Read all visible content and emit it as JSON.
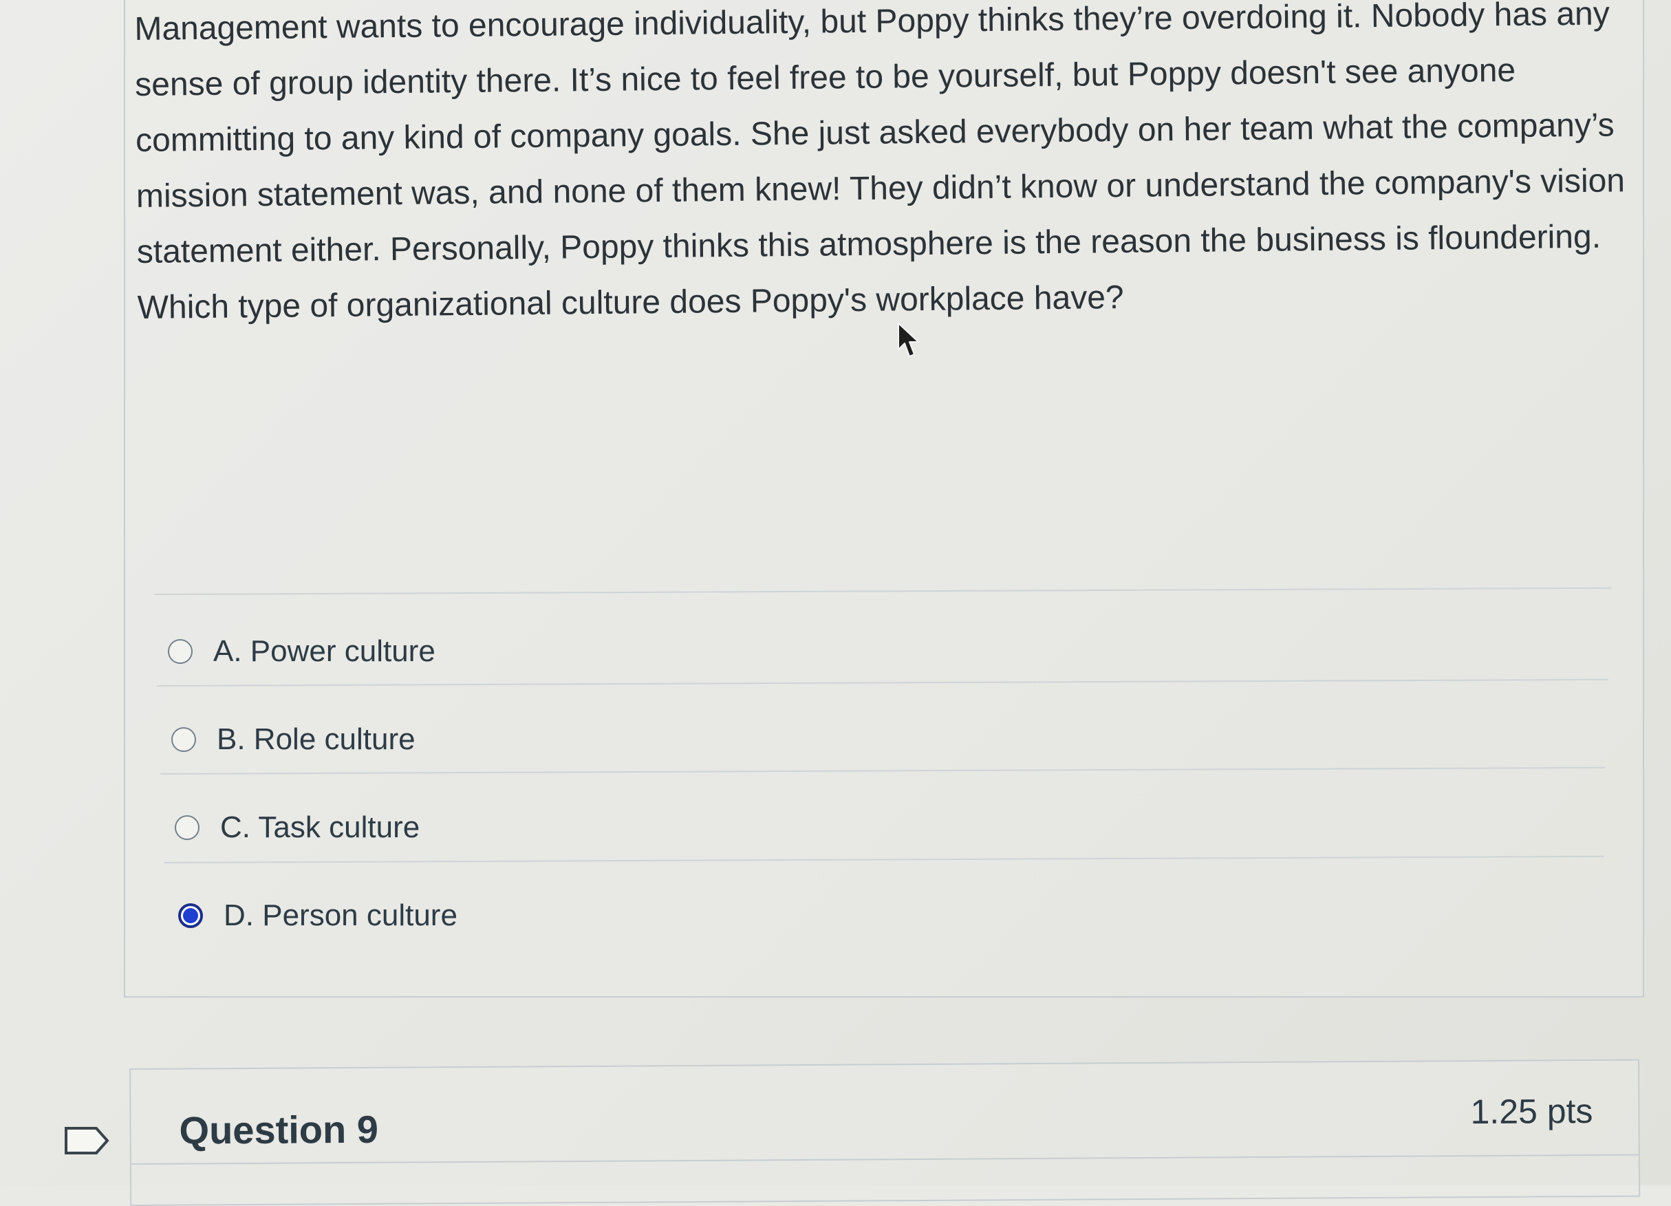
{
  "question": {
    "text": "Management wants to encourage individuality, but Poppy thinks they’re overdoing it. Nobody has any sense of group identity there. It’s nice to feel free to be yourself, but Poppy doesn't see anyone committing to any kind of company goals. She just asked everybody on her team what the company’s mission statement was, and none of them knew! They didn’t know or understand the company's vision statement either. Personally, Poppy thinks this atmosphere is the reason the business is floundering.  Which type of organizational culture does Poppy's workplace have?",
    "answers": [
      {
        "label": "A. Power culture",
        "selected": false
      },
      {
        "label": "B. Role culture",
        "selected": false
      },
      {
        "label": "C. Task culture",
        "selected": false
      },
      {
        "label": "D. Person culture",
        "selected": true
      }
    ]
  },
  "next_question": {
    "title": "Question 9",
    "points": "1.25 pts"
  },
  "icons": {
    "flag": "flag-outline-icon",
    "cursor": "mouse-pointer-icon",
    "radio": "radio-button-icon"
  },
  "colors": {
    "radio_selected": "#1f3fd0",
    "text": "#2d3b45",
    "border": "#c7cdd1"
  }
}
